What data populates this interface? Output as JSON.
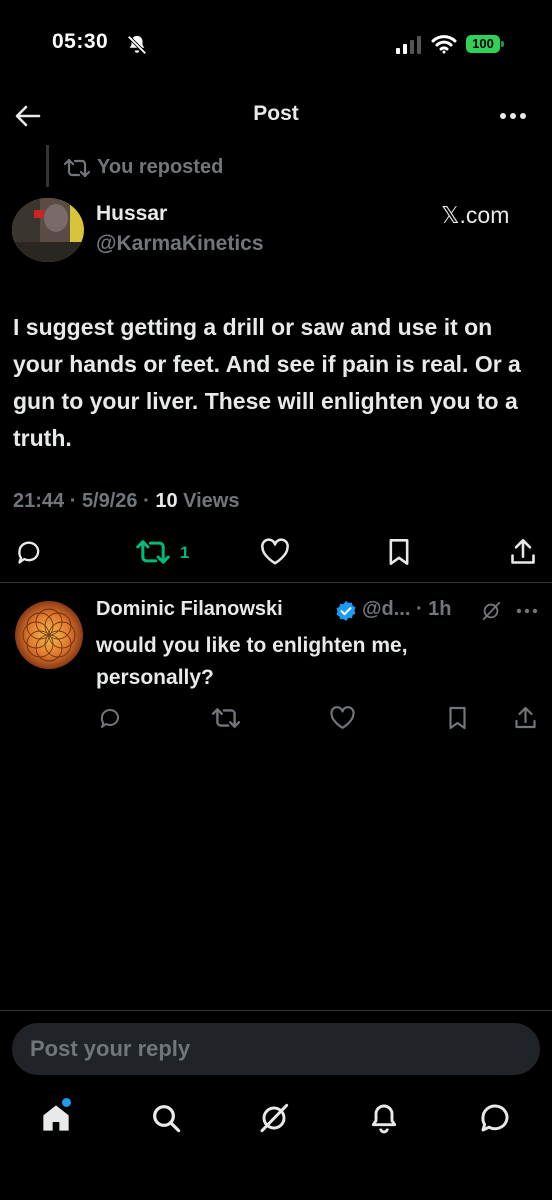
{
  "status_bar": {
    "time": "05:30",
    "battery": "100"
  },
  "header": {
    "title": "Post"
  },
  "post": {
    "repost_label": "You reposted",
    "author_name": "Hussar",
    "author_handle": "@KarmaKinetics",
    "source": "𝕏.com",
    "text": "I suggest getting a drill or saw and use it on your hands or feet. And see if pain is real. Or a gun to your liver. These will enlighten you to a truth.",
    "time": "21:44",
    "date": "5/9/26",
    "views_count": "10",
    "views_label": "Views",
    "retweet_count": "1"
  },
  "reply": {
    "author_name": "Dominic Filanowski",
    "author_handle": "@d...",
    "time": "1h",
    "text": "would you like to enlighten me, personally?"
  },
  "composer": {
    "placeholder": "Post your reply"
  },
  "colors": {
    "accent": "#1d9bf0",
    "retweet_green": "#00ba7c",
    "battery_green": "#30d158",
    "muted": "#71767b"
  }
}
